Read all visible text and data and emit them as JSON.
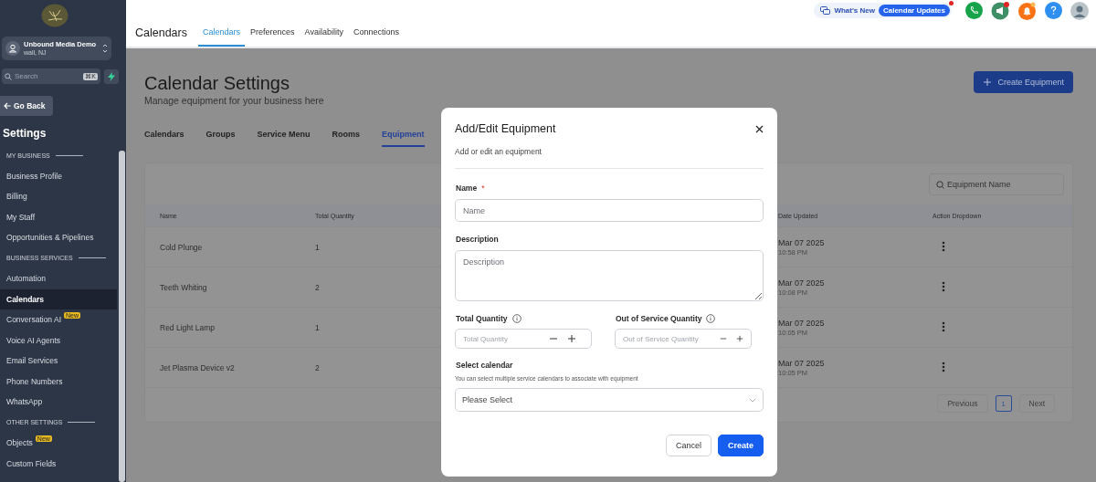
{
  "sidebar": {
    "account": {
      "name": "Unbound Media Demo",
      "location": "wall, NJ"
    },
    "search": {
      "placeholder": "Search",
      "shortcut": "⌘K"
    },
    "back_button": "Go Back",
    "title": "Settings",
    "items": [
      {
        "kind": "section",
        "label": "MY BUSINESS"
      },
      {
        "kind": "link",
        "label": "Business Profile",
        "selected": false
      },
      {
        "kind": "link",
        "label": "Billing",
        "selected": false
      },
      {
        "kind": "link",
        "label": "My Staff",
        "selected": false
      },
      {
        "kind": "link",
        "label": "Opportunities & Pipelines",
        "selected": false
      },
      {
        "kind": "section",
        "label": "BUSINESS SERVICES"
      },
      {
        "kind": "link",
        "label": "Automation",
        "selected": false
      },
      {
        "kind": "link",
        "label": "Calendars",
        "selected": true
      },
      {
        "kind": "link",
        "label": "Conversation AI",
        "selected": false,
        "badge": "New"
      },
      {
        "kind": "link",
        "label": "Voice AI Agents",
        "selected": false
      },
      {
        "kind": "link",
        "label": "Email Services",
        "selected": false
      },
      {
        "kind": "link",
        "label": "Phone Numbers",
        "selected": false
      },
      {
        "kind": "link",
        "label": "WhatsApp",
        "selected": false
      },
      {
        "kind": "section",
        "label": "OTHER SETTINGS"
      },
      {
        "kind": "link",
        "label": "Objects",
        "selected": false,
        "badge": "New"
      },
      {
        "kind": "link",
        "label": "Custom Fields",
        "selected": false
      }
    ]
  },
  "header": {
    "title": "Calendars",
    "whats_new": "What's New",
    "updates": "Calendar Updates",
    "tabs": [
      {
        "label": "Calendars",
        "selected": true
      },
      {
        "label": "Preferences",
        "selected": false
      },
      {
        "label": "Availability",
        "selected": false
      },
      {
        "label": "Connections",
        "selected": false
      }
    ]
  },
  "page": {
    "title": "Calendar Settings",
    "subtitle": "Manage equipment for your business here",
    "create_button": "Create Equipment",
    "tabs": [
      {
        "label": "Calendars",
        "selected": false
      },
      {
        "label": "Groups",
        "selected": false
      },
      {
        "label": "Service Menu",
        "selected": false
      },
      {
        "label": "Rooms",
        "selected": false
      },
      {
        "label": "Equipment",
        "selected": true
      }
    ],
    "table": {
      "search_placeholder": "Equipment Name",
      "columns": [
        "Name",
        "Total Quantity",
        "Date Updated",
        "Action Dropdown"
      ],
      "rows": [
        {
          "name": "Cold Plunge",
          "total_quantity": "1",
          "date": "Mar 07 2025",
          "time": "10:58 PM"
        },
        {
          "name": "Teeth Whiting",
          "total_quantity": "2",
          "date": "Mar 07 2025",
          "time": "10:08 PM"
        },
        {
          "name": "Red Light Lamp",
          "total_quantity": "1",
          "date": "Mar 07 2025",
          "time": "10:05 PM"
        },
        {
          "name": "Jet Plasma Device v2",
          "total_quantity": "2",
          "date": "Mar 07 2025",
          "time": "10:05 PM"
        }
      ]
    },
    "pagination": {
      "previous": "Previous",
      "pages": [
        {
          "label": "1",
          "selected": true
        }
      ],
      "next": "Next"
    }
  },
  "modal": {
    "title": "Add/Edit Equipment",
    "subtitle": "Add or edit an equipment",
    "name": {
      "label": "Name",
      "required_mark": "*",
      "placeholder": "Name"
    },
    "description": {
      "label": "Description",
      "placeholder": "Description"
    },
    "total_quantity": {
      "label": "Total Quantity",
      "placeholder": "Total Quantity"
    },
    "out_of_service": {
      "label": "Out of Service Quantity",
      "placeholder": "Out of Service Quantity"
    },
    "calendar": {
      "label": "Select calendar",
      "help": "You can select multiple service calendars to associate with equipment",
      "placeholder": "Please Select"
    },
    "buttons": [
      {
        "kind": "secondary",
        "label": "Cancel"
      },
      {
        "kind": "primary",
        "label": "Create"
      }
    ]
  }
}
